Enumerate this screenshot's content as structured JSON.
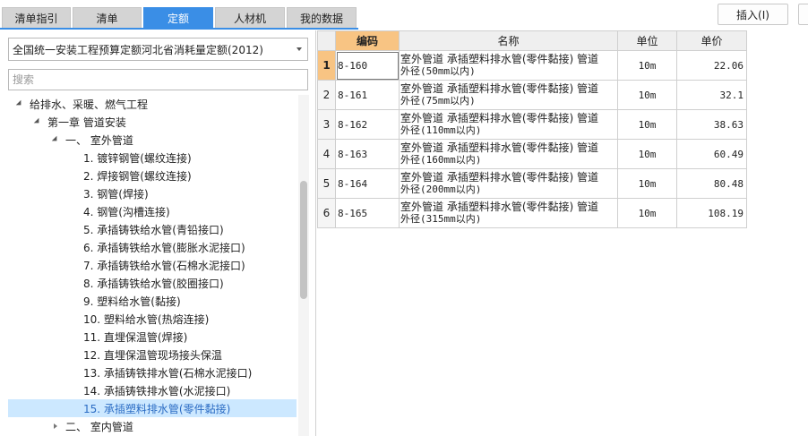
{
  "tabs": [
    {
      "label": "清单指引",
      "active": false
    },
    {
      "label": "清单",
      "active": false
    },
    {
      "label": "定额",
      "active": true
    },
    {
      "label": "人材机",
      "active": false
    },
    {
      "label": "我的数据",
      "active": false
    }
  ],
  "toolbar": {
    "insert_label": "插入(I)"
  },
  "left_panel": {
    "library_select": "全国统一安装工程预算定额河北省消耗量定额(2012)",
    "search_placeholder": "搜索",
    "tree": [
      {
        "label": "给排水、采暖、燃气工程",
        "level": 0,
        "arrow": "down"
      },
      {
        "label": "第一章 管道安装",
        "level": 1,
        "arrow": "down"
      },
      {
        "label": "一、 室外管道",
        "level": 2,
        "arrow": "down"
      },
      {
        "label": "1. 镀锌钢管(螺纹连接)",
        "level": 3
      },
      {
        "label": "2. 焊接钢管(螺纹连接)",
        "level": 3
      },
      {
        "label": "3. 钢管(焊接)",
        "level": 3
      },
      {
        "label": "4. 钢管(沟槽连接)",
        "level": 3
      },
      {
        "label": "5. 承插铸铁给水管(青铅接口)",
        "level": 3
      },
      {
        "label": "6. 承插铸铁给水管(膨胀水泥接口)",
        "level": 3
      },
      {
        "label": "7. 承插铸铁给水管(石棉水泥接口)",
        "level": 3
      },
      {
        "label": "8. 承插铸铁给水管(胶圈接口)",
        "level": 3
      },
      {
        "label": "9. 塑料给水管(黏接)",
        "level": 3
      },
      {
        "label": "10. 塑料给水管(热熔连接)",
        "level": 3
      },
      {
        "label": "11. 直埋保温管(焊接)",
        "level": 3
      },
      {
        "label": "12. 直埋保温管现场接头保温",
        "level": 3
      },
      {
        "label": "13. 承插铸铁排水管(石棉水泥接口)",
        "level": 3
      },
      {
        "label": "14. 承插铸铁排水管(水泥接口)",
        "level": 3
      },
      {
        "label": "15. 承插塑料排水管(零件黏接)",
        "level": 3,
        "selected": true
      },
      {
        "label": "二、 室内管道",
        "level": 2,
        "arrow": "right"
      }
    ]
  },
  "grid": {
    "headers": {
      "code": "编码",
      "name": "名称",
      "unit": "单位",
      "price": "单价"
    },
    "rows": [
      {
        "num": "1",
        "code": "8-160",
        "name1": "室外管道 承插塑料排水管(零件黏接) 管道",
        "name2": "外径(50mm以内)",
        "unit": "10m",
        "price": "22.06"
      },
      {
        "num": "2",
        "code": "8-161",
        "name1": "室外管道 承插塑料排水管(零件黏接) 管道",
        "name2": "外径(75mm以内)",
        "unit": "10m",
        "price": "32.1"
      },
      {
        "num": "3",
        "code": "8-162",
        "name1": "室外管道 承插塑料排水管(零件黏接) 管道",
        "name2": "外径(110mm以内)",
        "unit": "10m",
        "price": "38.63"
      },
      {
        "num": "4",
        "code": "8-163",
        "name1": "室外管道 承插塑料排水管(零件黏接) 管道",
        "name2": "外径(160mm以内)",
        "unit": "10m",
        "price": "60.49"
      },
      {
        "num": "5",
        "code": "8-164",
        "name1": "室外管道 承插塑料排水管(零件黏接) 管道",
        "name2": "外径(200mm以内)",
        "unit": "10m",
        "price": "80.48"
      },
      {
        "num": "6",
        "code": "8-165",
        "name1": "室外管道 承插塑料排水管(零件黏接) 管道",
        "name2": "外径(315mm以内)",
        "unit": "10m",
        "price": "108.19"
      }
    ]
  }
}
